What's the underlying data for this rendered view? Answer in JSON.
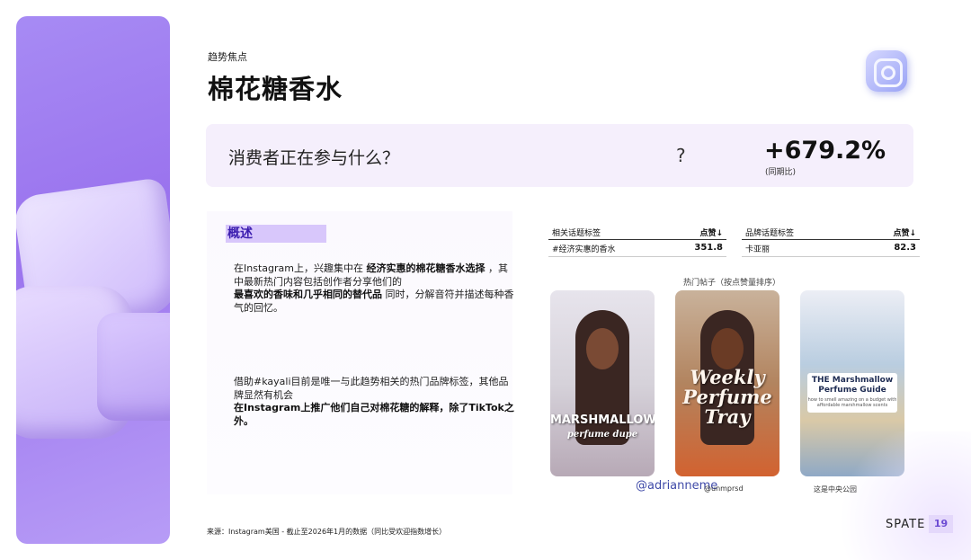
{
  "header": {
    "eyebrow": "趋势焦点",
    "title": "棉花糖香水",
    "logo_icon": "instagram-icon"
  },
  "banner": {
    "question": "消费者正在参与什么？",
    "question_mark": "?",
    "growth": "+679.2%",
    "growth_note": "(同期比)"
  },
  "overview": {
    "tag": "概述",
    "p1": {
      "a": "在Instagram上，兴趣集中在 ",
      "b1": "经济实惠的棉花糖香水选择",
      "c": " ，其中最新热门内容包括创作者分享他们的",
      "b2": "最喜欢的香味和几乎相同的替代品",
      "d": " 同时，分解音符并描述每种香气的回忆。"
    },
    "p2": {
      "a": "借助#kayali目前是唯一与此趋势相关的热门品牌标签，其他品牌显然有机会",
      "b": "在Instagram上推广他们自己对棉花糖的解释，除了TikTok之外。"
    }
  },
  "related_table": {
    "header_label": "相关话题标签",
    "header_sort": "点赞↓",
    "rows": [
      {
        "tag": "#经济实惠的香水",
        "value": "351.8"
      }
    ]
  },
  "brand_table": {
    "header_label": "品牌话题标签",
    "header_sort": "点赞↓",
    "rows": [
      {
        "tag": "卡亚丽",
        "value": "82.3"
      }
    ]
  },
  "posts": {
    "caption": "热门帖子（按点赞量排序）",
    "items": [
      {
        "overlay_a": "MARSHMALLOW",
        "overlay_b": "perfume dupe",
        "handle": "@adrianneme"
      },
      {
        "overlay_a": "Weekly Perfume Tray",
        "handle": "@unmprsd"
      },
      {
        "overlay_a": "THE Marshmallow Perfume Guide",
        "overlay_b": "how to smell amazing on a budget with affordable marshmallow scents",
        "handle": "这是中央公园"
      }
    ]
  },
  "footer": {
    "source": "来源：Instagram美国 - 截止至2026年1月的数据（同比受欢迎指数增长）",
    "brand": "SPATE",
    "page": "19"
  }
}
